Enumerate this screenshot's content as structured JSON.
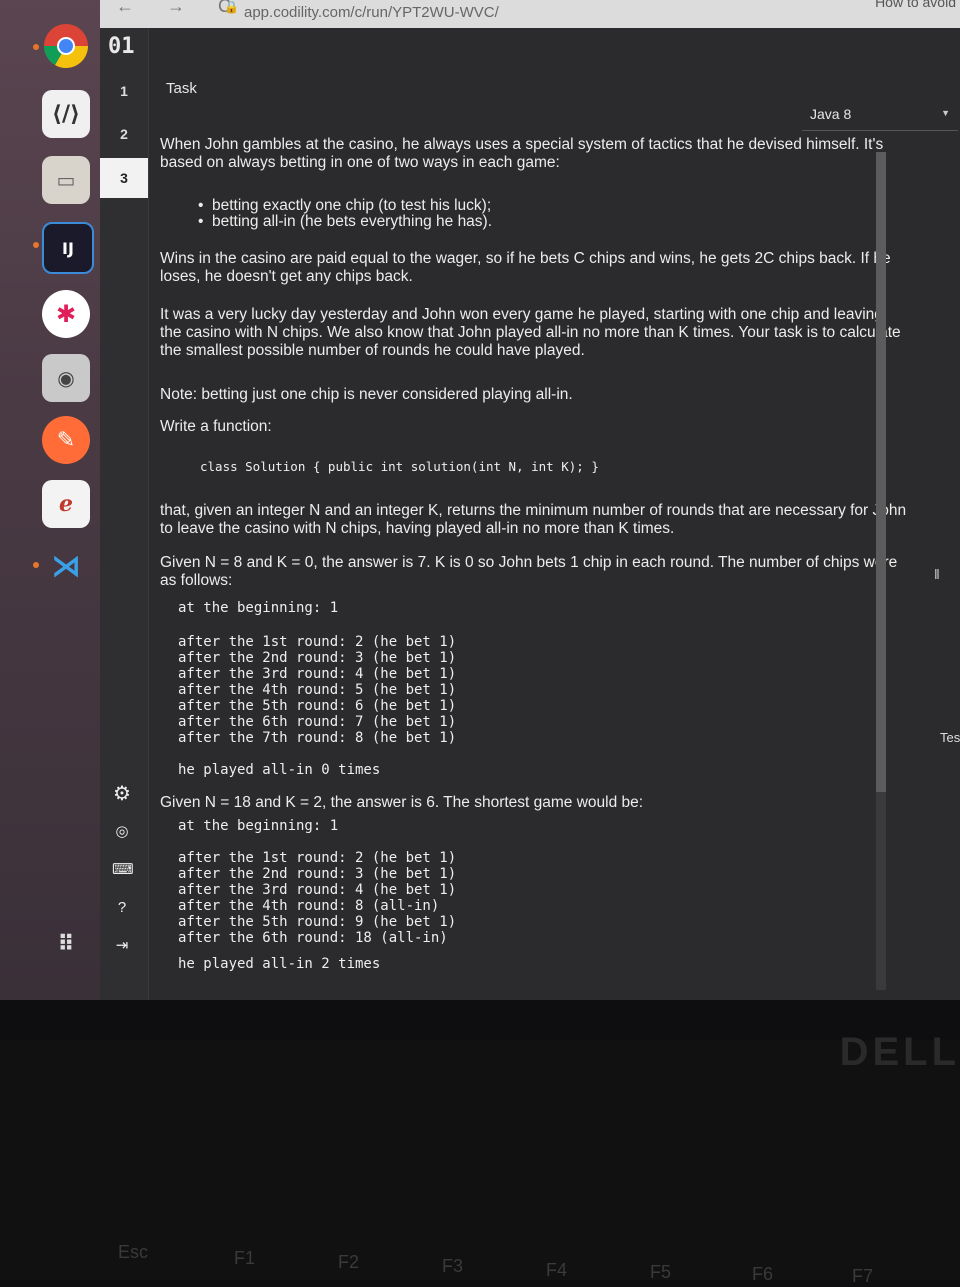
{
  "browser": {
    "url": "app.codility.com/c/run/YPT2WU-WVC/",
    "nav_arrows": "← → C",
    "lock": "🔒",
    "right_tab_text": "How to avoid"
  },
  "app": {
    "logo": "01",
    "task_tabs": [
      "1",
      "2",
      "3"
    ],
    "active_tab": "3",
    "task_title": "Task",
    "language": "Java 8",
    "test_tab": "Tes"
  },
  "task": {
    "intro": "When John gambles at the casino, he always uses a special system of tactics that he devised himself. It's based on always betting in one of two ways in each game:",
    "bullets": [
      "betting exactly one chip (to test his luck);",
      "betting all-in (he bets everything he has)."
    ],
    "p_wins": "Wins in the casino are paid equal to the wager, so if he bets C chips and wins, he gets 2C chips back. If he loses, he doesn't get any chips back.",
    "p_lucky": "It was a very lucky day yesterday and John won every game he played, starting with one chip and leaving the casino with N chips. We also know that John played all-in no more than K times. Your task is to calculate the smallest possible number of rounds he could have played.",
    "p_note": "Note: betting just one chip is never considered playing all-in.",
    "p_write": "Write a function:",
    "signature": "class Solution { public int solution(int N, int K); }",
    "p_that": "that, given an integer N and an integer K, returns the minimum number of rounds that are necessary for John to leave the casino with N chips, having played all-in no more than K times.",
    "example1_intro": "Given N = 8 and K = 0, the answer is 7. K is 0 so John bets 1 chip in each round. The number of chips were as follows:",
    "example1_begin": "at the beginning: 1",
    "example1_rounds": [
      "after the 1st round: 2 (he bet 1)",
      "after the 2nd round: 3 (he bet 1)",
      "after the 3rd round: 4 (he bet 1)",
      "after the 4th round: 5 (he bet 1)",
      "after the 5th round: 6 (he bet 1)",
      "after the 6th round: 7 (he bet 1)",
      "after the 7th round: 8 (he bet 1)"
    ],
    "example1_end": "he played all-in 0 times",
    "example2_intro": "Given N = 18 and K = 2, the answer is 6. The shortest game would be:",
    "example2_begin": "at the beginning: 1",
    "example2_rounds": [
      "after the 1st round: 2 (he bet 1)",
      "after the 2nd round: 3 (he bet 1)",
      "after the 3rd round: 4 (he bet 1)",
      "after the 4th round: 8 (all-in)",
      "after the 5th round: 9 (he bet 1)",
      "after the 6th round: 18 (all-in)"
    ],
    "example2_end": "he played all-in 2 times"
  },
  "keyboard": {
    "keys": [
      "Esc",
      "F1",
      "F2",
      "F3",
      "F4",
      "F5",
      "F6",
      "F7"
    ],
    "brand": "DELL"
  },
  "dock_icons": [
    "chrome-icon",
    "sublime-merge-icon",
    "files-icon",
    "intellij-icon",
    "slack-icon",
    "screenshot-icon",
    "postman-icon",
    "evince-icon",
    "vscode-icon",
    "apps-grid-icon"
  ]
}
